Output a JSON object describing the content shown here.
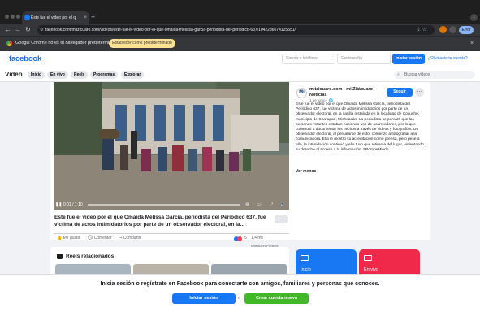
{
  "browser": {
    "tab_title": "Este fue el video por el q",
    "tab_close": "×",
    "new_tab": "+",
    "url": "facebook.com/mitzicuaro.com/videos/este-fue-el-video-por-el-que-omaida-melissa-garcia-periodista-del-periódico-637/1042286674125551/",
    "error_label": "Error",
    "infobar_text": "Google Chrome no es tu navegador predeterminado",
    "set_default_button": "Establecer como predeterminado",
    "infobar_close": "×"
  },
  "header": {
    "logo": "facebook",
    "email_placeholder": "Correo o teléfono",
    "password_placeholder": "Contraseña",
    "login_button": "Iniciar sesión",
    "forgot_link": "¿Olvidaste tu cuenta?"
  },
  "video_nav": {
    "title": "Video",
    "tabs": [
      "Inicio",
      "En vivo",
      "Reels",
      "Programas",
      "Explorar"
    ],
    "search_placeholder": "Buscar videos"
  },
  "video": {
    "time": "0:01 / 1:10",
    "title": "Este fue el video por el que Omaida Melissa García, periodista del Periódico 637, fue víctima de actos intimidatorios por parte de un observador electoral, en la...",
    "more": "···",
    "actions": {
      "like": "Me gusta",
      "comment": "Comentar",
      "share": "Compartir",
      "reaction_count": "5",
      "views": "1,4 mil visualizaciones"
    }
  },
  "post": {
    "avatar_text": "Mi",
    "page_name": "mitzicuaro.com - mi Zitácuaro Noticias",
    "date": "1 de junio · 🌐",
    "follow_button": "Seguir",
    "more": "···",
    "description": "Este fue el video por el que Omaida Melissa García, periodista del Periódico 637, fue víctima de actos intimidatorios por parte de un observador electoral, en la casilla instalada en la localidad de Cocucho, municipio de Charapan, Michoacán. La periodista se percató que las personas votantes estaban haciendo uso de acarreadores, por lo que comenzó a documentar los hechos a través de videos y fotografías. Un observador electoral, al percatarse de esto, comenzó a fotografiar a la comunicadora. Ella le mostró su acreditación como prensa, pero pese a ello, la intimidación continuó y ella tuvo que retirarse del lugar, violentando su derecho al acceso a la información. #RompeMiedo",
    "see_less": "Ver menos"
  },
  "reels": {
    "title": "Reels relacionados"
  },
  "side_cards": {
    "blue_label": "Inicio",
    "red_label": "En vivo"
  },
  "banner": {
    "text": "Inicia sesión o regístrate en Facebook para conectarte con amigos, familiares y personas que conoces.",
    "login_button": "Iniciar sesión",
    "or": "o",
    "create_button": "Crear cuenta nueva"
  }
}
